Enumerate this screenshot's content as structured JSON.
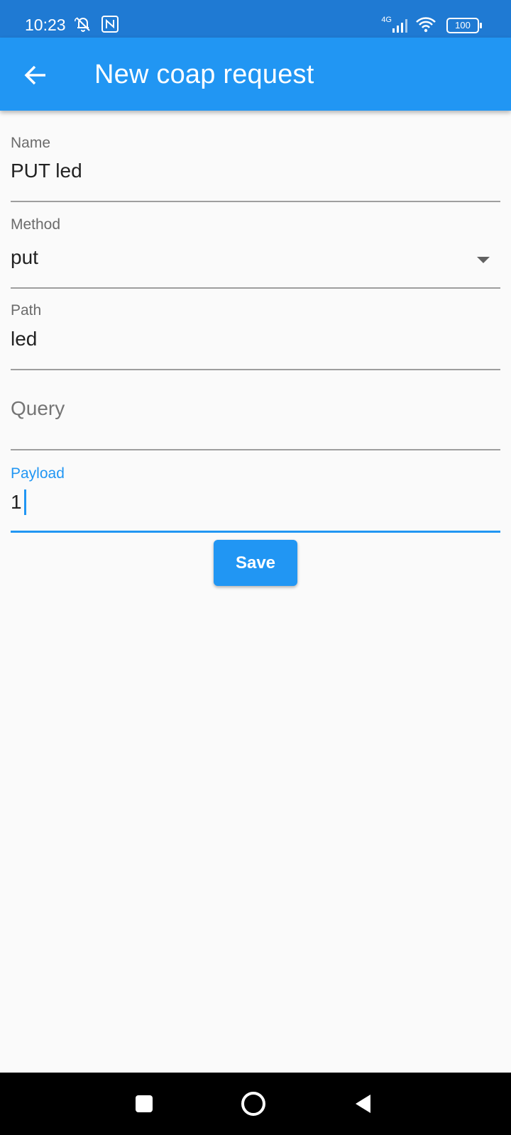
{
  "status_bar": {
    "time": "10:23",
    "network": "4G",
    "battery": "100",
    "icons": [
      "bell-off-icon",
      "nfc-icon",
      "signal-icon",
      "wifi-icon",
      "battery-icon"
    ]
  },
  "app_bar": {
    "title": "New coap request",
    "back_icon": "arrow-back-icon"
  },
  "form": {
    "name": {
      "label": "Name",
      "value": "PUT led"
    },
    "method": {
      "label": "Method",
      "value": "put"
    },
    "path": {
      "label": "Path",
      "value": "led"
    },
    "query": {
      "label": "Query",
      "value": ""
    },
    "payload": {
      "label": "Payload",
      "value": "1"
    },
    "save_label": "Save"
  },
  "nav_bar": {
    "icons": [
      "recents-square-icon",
      "home-circle-icon",
      "back-triangle-icon"
    ]
  },
  "colors": {
    "status_bar": "#1f7ad3",
    "primary": "#2196f3",
    "background": "#fafafa",
    "nav_bar": "#000000"
  }
}
